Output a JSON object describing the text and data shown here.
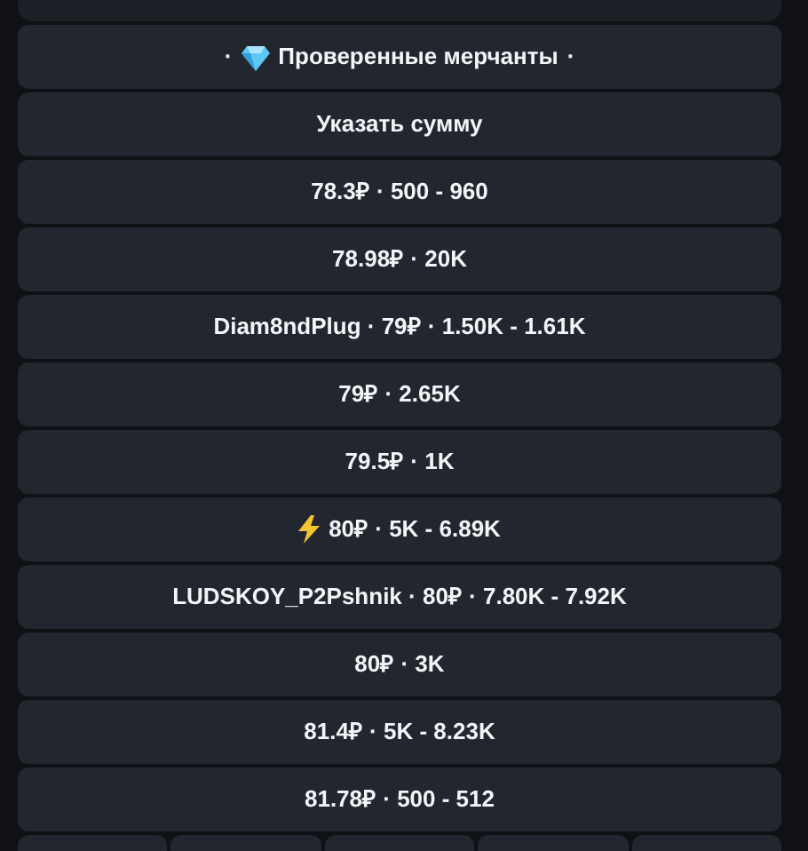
{
  "keyboard": [
    {
      "kind": "diamond",
      "prefix": "·",
      "label": "Проверенные мерчанты",
      "suffix": "·"
    },
    {
      "kind": "plain",
      "label": "Указать сумму"
    },
    {
      "kind": "plain",
      "label": "78.3₽ · 500 - 960"
    },
    {
      "kind": "plain",
      "label": "78.98₽ · 20K"
    },
    {
      "kind": "plain",
      "label": "Diam8ndPlug · 79₽ · 1.50K - 1.61K"
    },
    {
      "kind": "plain",
      "label": "79₽ · 2.65K"
    },
    {
      "kind": "plain",
      "label": "79.5₽ · 1K"
    },
    {
      "kind": "lightning",
      "label": "80₽ · 5K - 6.89K"
    },
    {
      "kind": "plain",
      "label": "LUDSKOY_P2Pshnik · 80₽ · 7.80K - 7.92K"
    },
    {
      "kind": "plain",
      "label": "80₽ · 3K"
    },
    {
      "kind": "plain",
      "label": "81.4₽ · 5K - 8.23K"
    },
    {
      "kind": "plain",
      "label": "81.78₽ · 500 - 512"
    }
  ]
}
